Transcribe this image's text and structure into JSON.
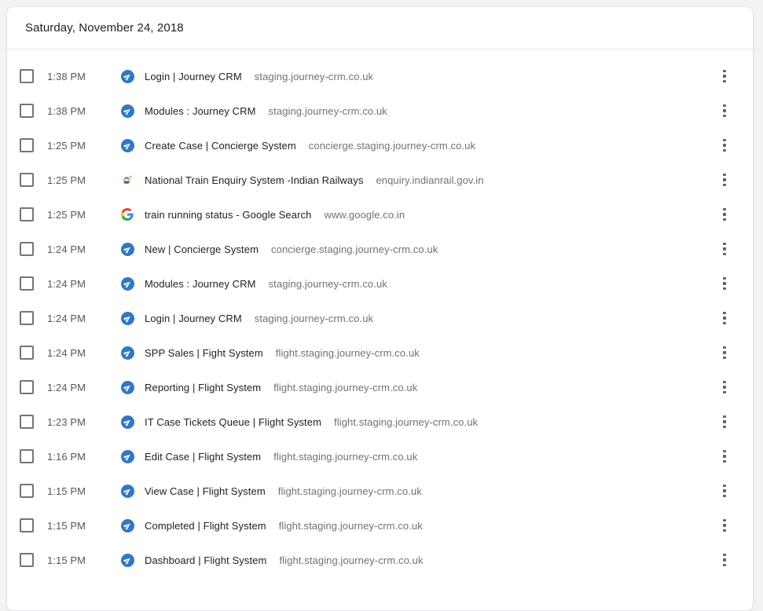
{
  "page": {
    "type": "browser-history",
    "colors": {
      "page_background": "#f1f3f4",
      "card_background": "#ffffff",
      "title_text": "#202124",
      "secondary_text": "#5f6368",
      "journey_crm_favicon_blue": "#3077c8",
      "google_favicon_colors": [
        "#EA4335",
        "#4285F4",
        "#FBBC05",
        "#34A853"
      ]
    }
  },
  "card": {
    "date_header": "Saturday, November 24, 2018"
  },
  "icons": {
    "row_menu": "kebab-menu-icon"
  },
  "history": {
    "rows": [
      {
        "time": "1:38 PM",
        "title": "Login | Journey CRM",
        "domain": "staging.journey-crm.co.uk",
        "favicon": "journey-crm-favicon"
      },
      {
        "time": "1:38 PM",
        "title": "Modules : Journey CRM",
        "domain": "staging.journey-crm.co.uk",
        "favicon": "journey-crm-favicon"
      },
      {
        "time": "1:25 PM",
        "title": "Create Case | Concierge System",
        "domain": "concierge.staging.journey-crm.co.uk",
        "favicon": "journey-crm-favicon"
      },
      {
        "time": "1:25 PM",
        "title": "National Train Enquiry System -Indian Railways",
        "domain": "enquiry.indianrail.gov.in",
        "favicon": "indian-railways-favicon"
      },
      {
        "time": "1:25 PM",
        "title": "train running status - Google Search",
        "domain": "www.google.co.in",
        "favicon": "google-favicon"
      },
      {
        "time": "1:24 PM",
        "title": "New | Concierge System",
        "domain": "concierge.staging.journey-crm.co.uk",
        "favicon": "journey-crm-favicon"
      },
      {
        "time": "1:24 PM",
        "title": "Modules : Journey CRM",
        "domain": "staging.journey-crm.co.uk",
        "favicon": "journey-crm-favicon"
      },
      {
        "time": "1:24 PM",
        "title": "Login | Journey CRM",
        "domain": "staging.journey-crm.co.uk",
        "favicon": "journey-crm-favicon"
      },
      {
        "time": "1:24 PM",
        "title": "SPP Sales | Fight System",
        "domain": "flight.staging.journey-crm.co.uk",
        "favicon": "journey-crm-favicon"
      },
      {
        "time": "1:24 PM",
        "title": "Reporting | Flight System",
        "domain": "flight.staging.journey-crm.co.uk",
        "favicon": "journey-crm-favicon"
      },
      {
        "time": "1:23 PM",
        "title": "IT Case Tickets Queue | Flight System",
        "domain": "flight.staging.journey-crm.co.uk",
        "favicon": "journey-crm-favicon"
      },
      {
        "time": "1:16 PM",
        "title": "Edit Case | Flight System",
        "domain": "flight.staging.journey-crm.co.uk",
        "favicon": "journey-crm-favicon"
      },
      {
        "time": "1:15 PM",
        "title": "View Case | Flight System",
        "domain": "flight.staging.journey-crm.co.uk",
        "favicon": "journey-crm-favicon"
      },
      {
        "time": "1:15 PM",
        "title": "Completed | Flight System",
        "domain": "flight.staging.journey-crm.co.uk",
        "favicon": "journey-crm-favicon"
      },
      {
        "time": "1:15 PM",
        "title": "Dashboard | Flight System",
        "domain": "flight.staging.journey-crm.co.uk",
        "favicon": "journey-crm-favicon"
      }
    ]
  }
}
